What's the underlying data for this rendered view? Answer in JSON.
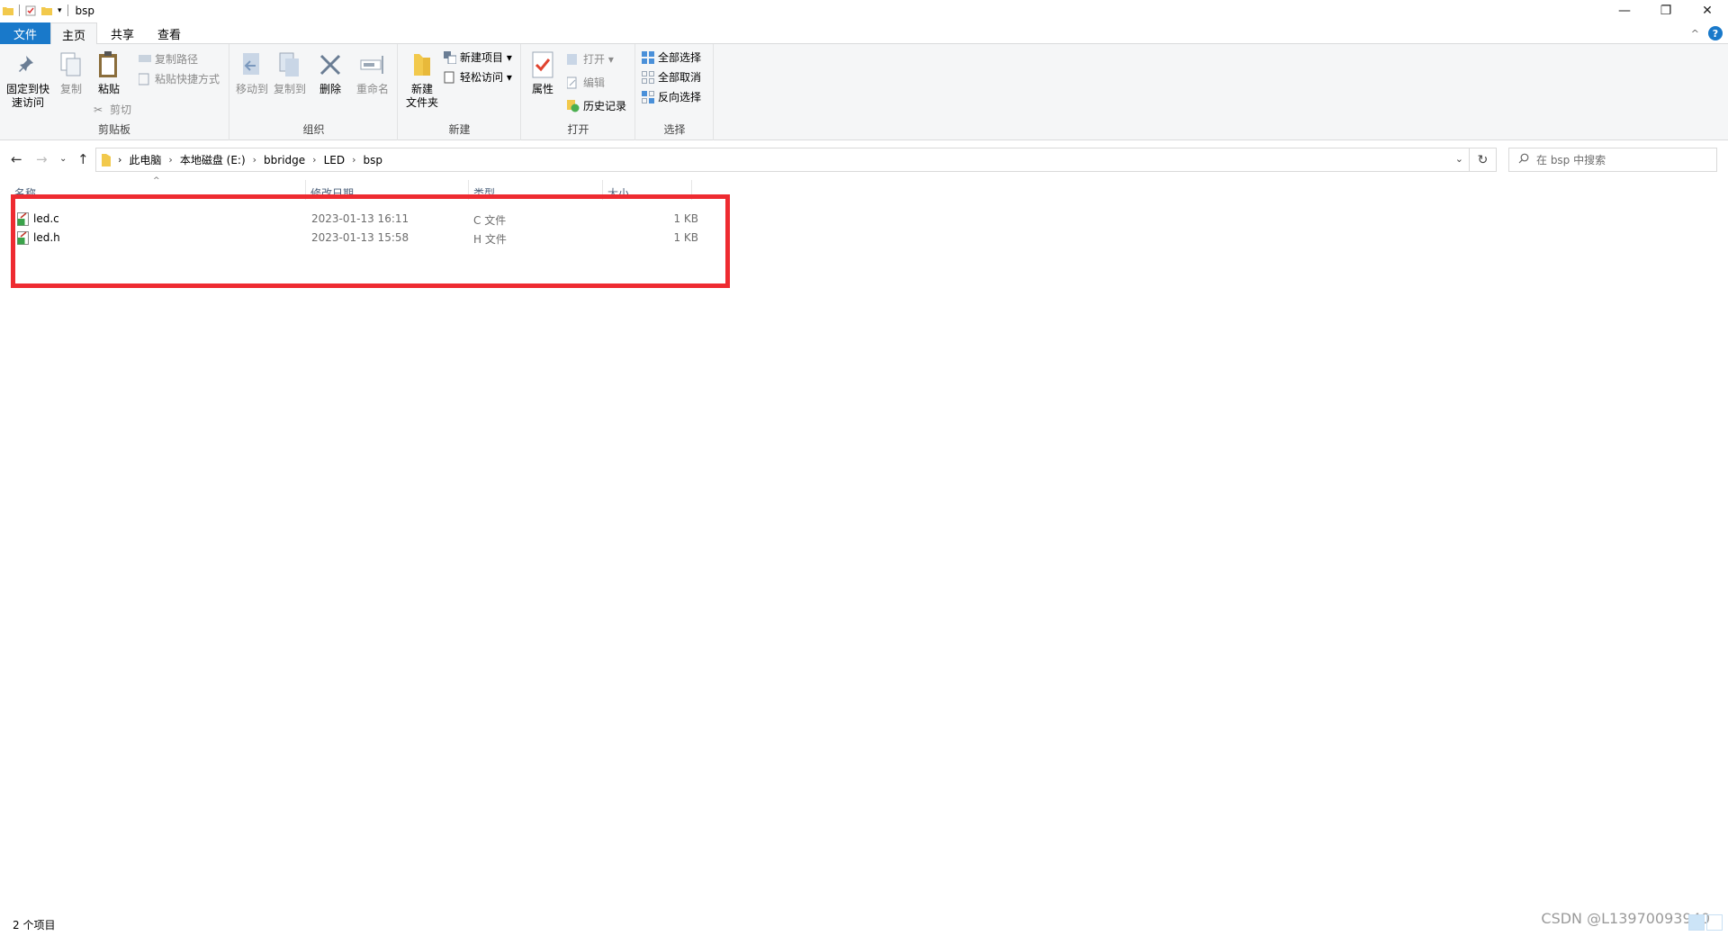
{
  "window": {
    "title": "bsp",
    "controls": {
      "minimize": "—",
      "restore": "❐",
      "close": "✕"
    }
  },
  "menu": {
    "file": "文件",
    "home": "主页",
    "share": "共享",
    "view": "查看",
    "help": "?",
    "collapse": "^"
  },
  "ribbon": {
    "clipboard": {
      "label": "剪贴板",
      "pin": "固定到快\n速访问",
      "pin_l1": "固定到快",
      "pin_l2": "速访问",
      "copy": "复制",
      "paste": "粘贴",
      "copy_path": "复制路径",
      "paste_shortcut": "粘贴快捷方式",
      "cut": "剪切"
    },
    "organize": {
      "label": "组织",
      "move_to": "移动到",
      "copy_to": "复制到",
      "delete": "删除",
      "rename": "重命名"
    },
    "new": {
      "label": "新建",
      "new_folder_l1": "新建",
      "new_folder_l2": "文件夹",
      "new_item": "新建项目 ▾",
      "easy_access": "轻松访问 ▾"
    },
    "open": {
      "label": "打开",
      "properties": "属性",
      "open": "打开 ▾",
      "edit": "编辑",
      "history": "历史记录"
    },
    "select": {
      "label": "选择",
      "select_all": "全部选择",
      "select_none": "全部取消",
      "invert": "反向选择"
    }
  },
  "address": {
    "crumbs": [
      "此电脑",
      "本地磁盘 (E:)",
      "bbridge",
      "LED",
      "bsp"
    ],
    "search_placeholder": "在 bsp 中搜索"
  },
  "columns": {
    "name": "名称",
    "date": "修改日期",
    "type": "类型",
    "size": "大小"
  },
  "files": [
    {
      "name": "led.c",
      "date": "2023-01-13 16:11",
      "type": "C 文件",
      "size": "1 KB"
    },
    {
      "name": "led.h",
      "date": "2023-01-13 15:58",
      "type": "H 文件",
      "size": "1 KB"
    }
  ],
  "status": {
    "count": "2 个项目",
    "watermark": "CSDN @L13970093940"
  },
  "colors": {
    "accent": "#1979ca",
    "highlight_box": "#ee2b31"
  }
}
